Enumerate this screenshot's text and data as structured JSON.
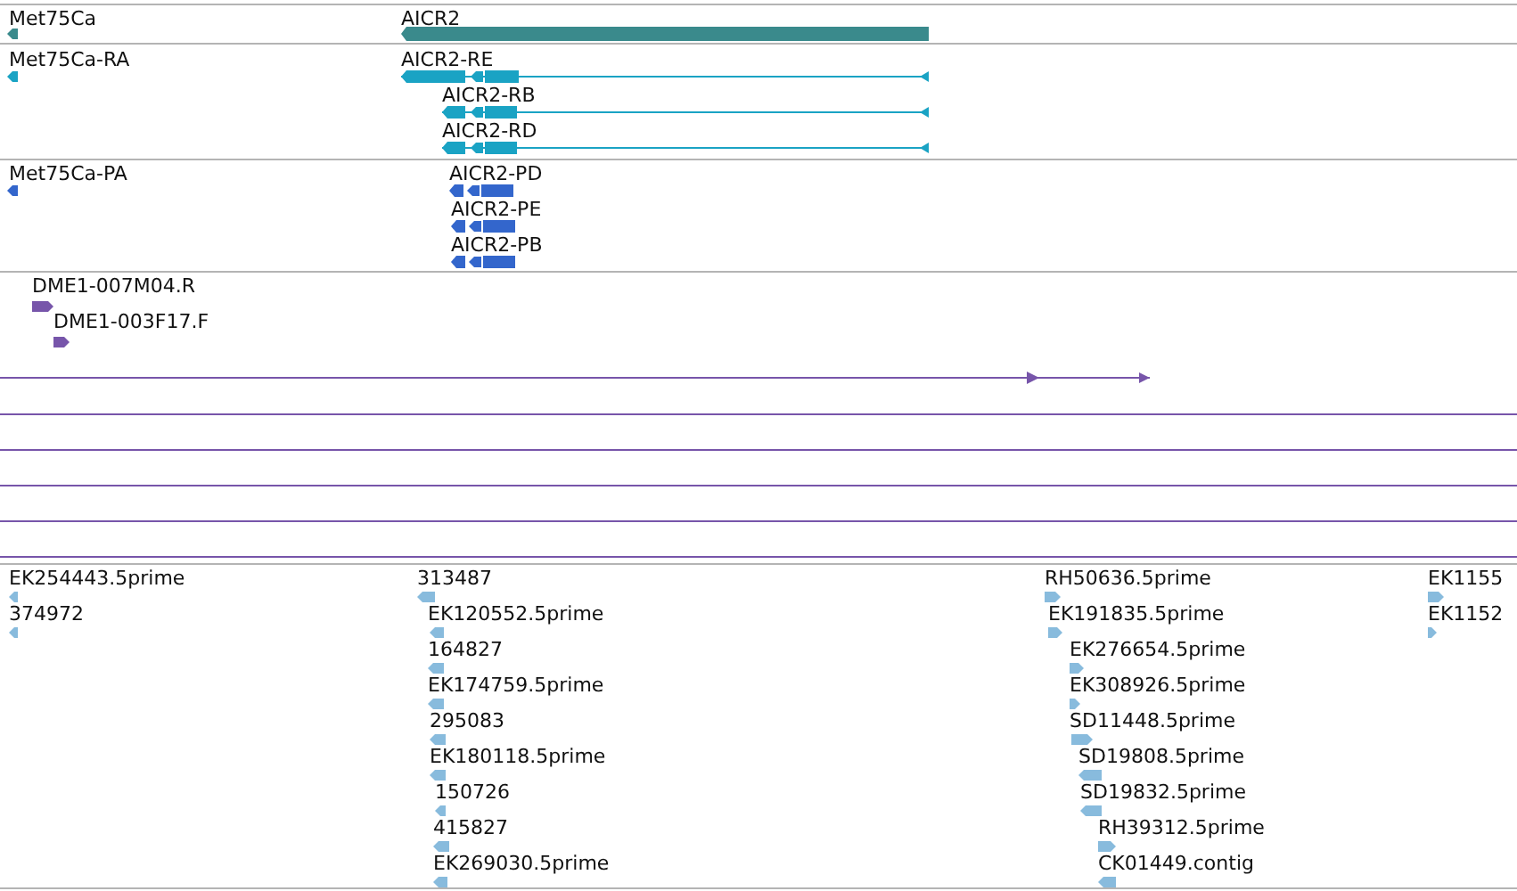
{
  "tracks": [
    {
      "color": "#3a8a8c",
      "features": [
        {
          "label": "Met75Ca",
          "reverse_strand": true
        },
        {
          "label": "AICR2",
          "reverse_strand": true
        }
      ]
    },
    {
      "color": "#1aa3c4",
      "features": [
        {
          "label": "Met75Ca-RA",
          "reverse_strand": true
        },
        {
          "label": "AICR2-RE",
          "reverse_strand": true
        },
        {
          "label": "AICR2-RB",
          "reverse_strand": true
        },
        {
          "label": "AICR2-RD",
          "reverse_strand": true
        }
      ]
    },
    {
      "color": "#3366cc",
      "features": [
        {
          "label": "Met75Ca-PA",
          "reverse_strand": true
        },
        {
          "label": "AICR2-PD",
          "reverse_strand": true
        },
        {
          "label": "AICR2-PE",
          "reverse_strand": true
        },
        {
          "label": "AICR2-PB",
          "reverse_strand": true
        }
      ]
    },
    {
      "color": "#7755aa",
      "features": [
        {
          "label": "DME1-007M04.R",
          "reverse_strand": false
        },
        {
          "label": "DME1-003F17.F",
          "reverse_strand": false
        },
        {
          "reverse_strand": false
        }
      ]
    },
    {
      "color": "#88bbdd",
      "features": [
        {
          "label": "EK254443.5prime",
          "reverse_strand": true
        },
        {
          "label": "374972",
          "reverse_strand": true
        },
        {
          "label": "313487",
          "reverse_strand": true
        },
        {
          "label": "EK120552.5prime",
          "reverse_strand": true
        },
        {
          "label": "164827",
          "reverse_strand": true
        },
        {
          "label": "EK174759.5prime",
          "reverse_strand": true
        },
        {
          "label": "295083",
          "reverse_strand": true
        },
        {
          "label": "EK180118.5prime",
          "reverse_strand": true
        },
        {
          "label": "150726",
          "reverse_strand": true
        },
        {
          "label": "415827",
          "reverse_strand": true
        },
        {
          "label": "EK269030.5prime",
          "reverse_strand": true
        },
        {
          "label": "RH50636.5prime",
          "reverse_strand": false
        },
        {
          "label": "EK191835.5prime",
          "reverse_strand": false
        },
        {
          "label": "EK276654.5prime",
          "reverse_strand": false
        },
        {
          "label": "EK308926.5prime",
          "reverse_strand": false
        },
        {
          "label": "SD11448.5prime",
          "reverse_strand": false
        },
        {
          "label": "SD19808.5prime",
          "reverse_strand": true
        },
        {
          "label": "SD19832.5prime",
          "reverse_strand": true
        },
        {
          "label": "RH39312.5prime",
          "reverse_strand": false
        },
        {
          "label": "CK01449.contig",
          "reverse_strand": true
        },
        {
          "label": "EK1155",
          "reverse_strand": false
        },
        {
          "label": "EK1152",
          "reverse_strand": false
        }
      ]
    }
  ]
}
